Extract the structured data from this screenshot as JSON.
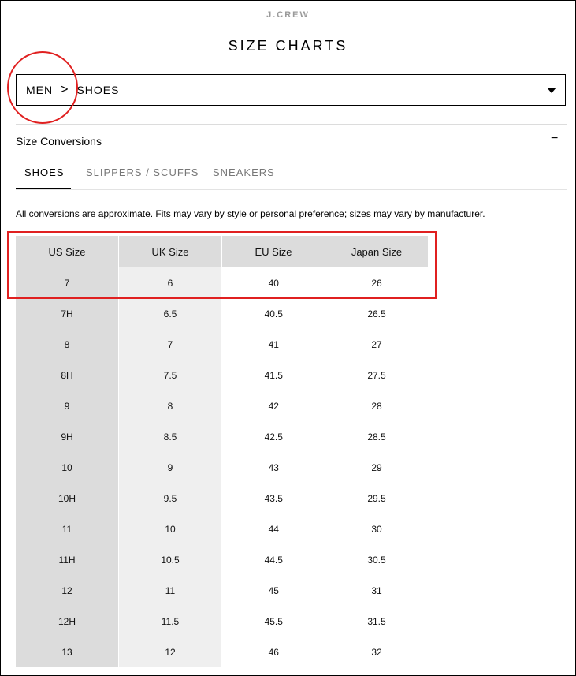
{
  "brand": "J.CREW",
  "page_title": "SIZE CHARTS",
  "selector": {
    "category": "MEN",
    "separator": ">",
    "subcategory": "SHOES"
  },
  "section": {
    "title": "Size Conversions",
    "collapse_symbol": "−"
  },
  "tabs": [
    {
      "label": "SHOES",
      "active": true
    },
    {
      "label": "SLIPPERS / SCUFFS",
      "active": false
    },
    {
      "label": "SNEAKERS",
      "active": false
    }
  ],
  "note": "All conversions are approximate. Fits may vary by style or personal preference; sizes may vary by manufacturer.",
  "table": {
    "headers": [
      "US Size",
      "UK Size",
      "EU Size",
      "Japan Size"
    ],
    "rows": [
      [
        "7",
        "6",
        "40",
        "26"
      ],
      [
        "7H",
        "6.5",
        "40.5",
        "26.5"
      ],
      [
        "8",
        "7",
        "41",
        "27"
      ],
      [
        "8H",
        "7.5",
        "41.5",
        "27.5"
      ],
      [
        "9",
        "8",
        "42",
        "28"
      ],
      [
        "9H",
        "8.5",
        "42.5",
        "28.5"
      ],
      [
        "10",
        "9",
        "43",
        "29"
      ],
      [
        "10H",
        "9.5",
        "43.5",
        "29.5"
      ],
      [
        "11",
        "10",
        "44",
        "30"
      ],
      [
        "11H",
        "10.5",
        "44.5",
        "30.5"
      ],
      [
        "12",
        "11",
        "45",
        "31"
      ],
      [
        "12H",
        "11.5",
        "45.5",
        "31.5"
      ],
      [
        "13",
        "12",
        "46",
        "32"
      ]
    ]
  },
  "colors": {
    "annotation": "#e02020",
    "header_bg": "#dcdcdc",
    "uk_column_bg": "#efefef"
  }
}
